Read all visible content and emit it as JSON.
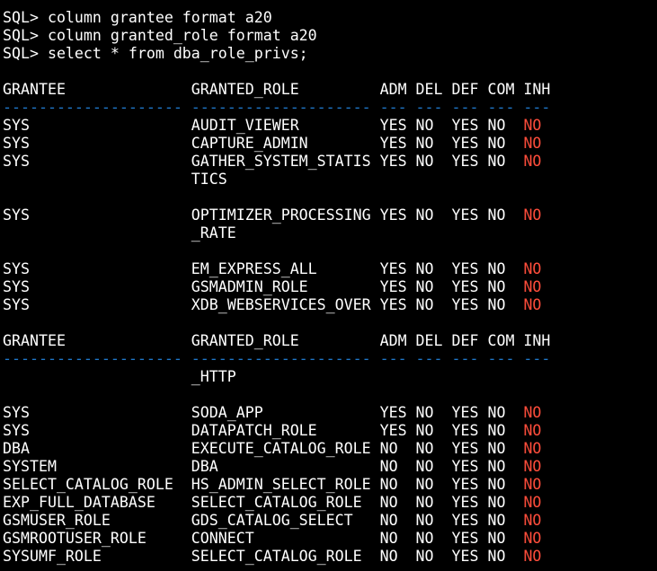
{
  "terminal": {
    "lines": [
      {
        "type": "text",
        "text": "SQL> column grantee format a20"
      },
      {
        "type": "text",
        "text": "SQL> column granted_role format a20"
      },
      {
        "type": "text",
        "text": "SQL> select * from dba_role_privs;"
      },
      {
        "type": "blank"
      },
      {
        "type": "header",
        "text": "GRANTEE              GRANTED_ROLE         ADM DEL DEF COM INH"
      },
      {
        "type": "sep",
        "text": "-------------------- -------------------- --- --- --- --- ---"
      },
      {
        "type": "row",
        "text": "SYS                  AUDIT_VIEWER         YES NO  YES NO  ",
        "inh": "NO"
      },
      {
        "type": "row",
        "text": "SYS                  CAPTURE_ADMIN        YES NO  YES NO  ",
        "inh": "NO"
      },
      {
        "type": "row",
        "text": "SYS                  GATHER_SYSTEM_STATIS YES NO  YES NO  ",
        "inh": "NO"
      },
      {
        "type": "text",
        "text": "                     TICS"
      },
      {
        "type": "blank"
      },
      {
        "type": "row",
        "text": "SYS                  OPTIMIZER_PROCESSING YES NO  YES NO  ",
        "inh": "NO"
      },
      {
        "type": "text",
        "text": "                     _RATE"
      },
      {
        "type": "blank"
      },
      {
        "type": "row",
        "text": "SYS                  EM_EXPRESS_ALL       YES NO  YES NO  ",
        "inh": "NO"
      },
      {
        "type": "row",
        "text": "SYS                  GSMADMIN_ROLE        YES NO  YES NO  ",
        "inh": "NO"
      },
      {
        "type": "row",
        "text": "SYS                  XDB_WEBSERVICES_OVER YES NO  YES NO  ",
        "inh": "NO"
      },
      {
        "type": "blank"
      },
      {
        "type": "header",
        "text": "GRANTEE              GRANTED_ROLE         ADM DEL DEF COM INH"
      },
      {
        "type": "sep",
        "text": "-------------------- -------------------- --- --- --- --- ---"
      },
      {
        "type": "text",
        "text": "                     _HTTP"
      },
      {
        "type": "blank"
      },
      {
        "type": "row",
        "text": "SYS                  SODA_APP             YES NO  YES NO  ",
        "inh": "NO"
      },
      {
        "type": "row",
        "text": "SYS                  DATAPATCH_ROLE       YES NO  YES NO  ",
        "inh": "NO"
      },
      {
        "type": "row",
        "text": "DBA                  EXECUTE_CATALOG_ROLE NO  NO  YES NO  ",
        "inh": "NO"
      },
      {
        "type": "row",
        "text": "SYSTEM               DBA                  NO  NO  YES NO  ",
        "inh": "NO"
      },
      {
        "type": "row",
        "text": "SELECT_CATALOG_ROLE  HS_ADMIN_SELECT_ROLE NO  NO  YES NO  ",
        "inh": "NO"
      },
      {
        "type": "row",
        "text": "EXP_FULL_DATABASE    SELECT_CATALOG_ROLE  NO  NO  YES NO  ",
        "inh": "NO"
      },
      {
        "type": "row",
        "text": "GSMUSER_ROLE         GDS_CATALOG_SELECT   NO  NO  YES NO  ",
        "inh": "NO"
      },
      {
        "type": "row",
        "text": "GSMROOTUSER_ROLE     CONNECT              NO  NO  YES NO  ",
        "inh": "NO"
      },
      {
        "type": "row",
        "text": "SYSUMF_ROLE          SELECT_CATALOG_ROLE  NO  NO  YES NO  ",
        "inh": "NO"
      }
    ]
  },
  "colors": {
    "background": "#000000",
    "text": "#ffffff",
    "separator": "#1f78c9",
    "inherited": "#ff4d3b"
  }
}
